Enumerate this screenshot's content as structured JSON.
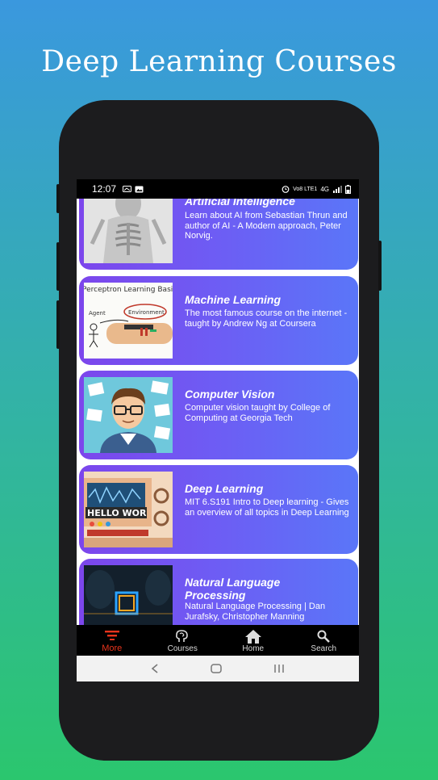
{
  "headline": "Deep Learning Courses",
  "status_bar": {
    "time": "12:07",
    "network_label": "Vo8 LTE1",
    "signal_label": "4G"
  },
  "courses": [
    {
      "title": "Artificial Intelligence",
      "description": "Learn about AI from Sebastian Thrun and author of AI - A Modern approach, Peter Norvig.",
      "thumbnail_icon": "robot-skeleton-image"
    },
    {
      "title": "Machine Learning",
      "description": "The most famous course on the internet - taught by Andrew Ng at Coursera",
      "thumbnail_icon": "whiteboard-drawing-image",
      "thumb_texts": [
        "Perceptron Learning Basics",
        "Agent",
        "Environment"
      ]
    },
    {
      "title": "Computer Vision",
      "description": "Computer vision taught by College of Computing at Georgia Tech",
      "thumbnail_icon": "man-with-glasses-illustration"
    },
    {
      "title": "Deep Learning",
      "description": "MIT 6.S191 Intro to Deep learning - Gives an overview of all topics in Deep Learning",
      "thumbnail_icon": "hello-world-machine-illustration",
      "thumb_texts": [
        "HELLO WOR"
      ]
    },
    {
      "title": "Natural Language Processing",
      "description": "Natural Language Processing | Dan Jurafsky, Christopher Manning",
      "thumbnail_icon": "neon-square-image"
    }
  ],
  "bottom_nav": [
    {
      "label": "More",
      "icon": "menu-lines-icon",
      "active": true
    },
    {
      "label": "Courses",
      "icon": "brain-icon",
      "active": false
    },
    {
      "label": "Home",
      "icon": "home-icon",
      "active": false
    },
    {
      "label": "Search",
      "icon": "search-icon",
      "active": false
    }
  ],
  "colors": {
    "accent": "#e8341c",
    "card_start": "#7c46ec",
    "card_end": "#5a76f8"
  }
}
